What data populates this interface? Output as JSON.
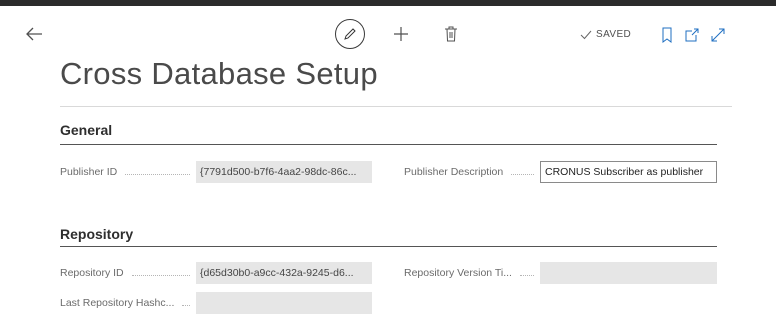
{
  "toolbar": {
    "saved_label": "SAVED",
    "icons": [
      "back-arrow-icon",
      "pencil-icon",
      "plus-icon",
      "trash-icon",
      "checkmark-icon",
      "bookmark-icon",
      "open-new-window-icon",
      "expand-icon"
    ]
  },
  "page": {
    "title": "Cross Database Setup"
  },
  "sections": {
    "general": {
      "title": "General",
      "publisher_id_label": "Publisher ID",
      "publisher_id_value": "{7791d500-b7f6-4aa2-98dc-86c...",
      "publisher_description_label": "Publisher Description",
      "publisher_description_value": "CRONUS Subscriber as publisher"
    },
    "repository": {
      "title": "Repository",
      "repository_id_label": "Repository ID",
      "repository_id_value": "{d65d30b0-a9cc-432a-9245-d6...",
      "repository_version_label": "Repository Version Ti...",
      "repository_version_value": "",
      "last_hash_label": "Last Repository Hashc...",
      "last_hash_value": ""
    }
  },
  "colors": {
    "top_bar": "#2b2b2b",
    "field_readonly_bg": "#e6e6e6",
    "label_text": "#6b6b6b"
  }
}
